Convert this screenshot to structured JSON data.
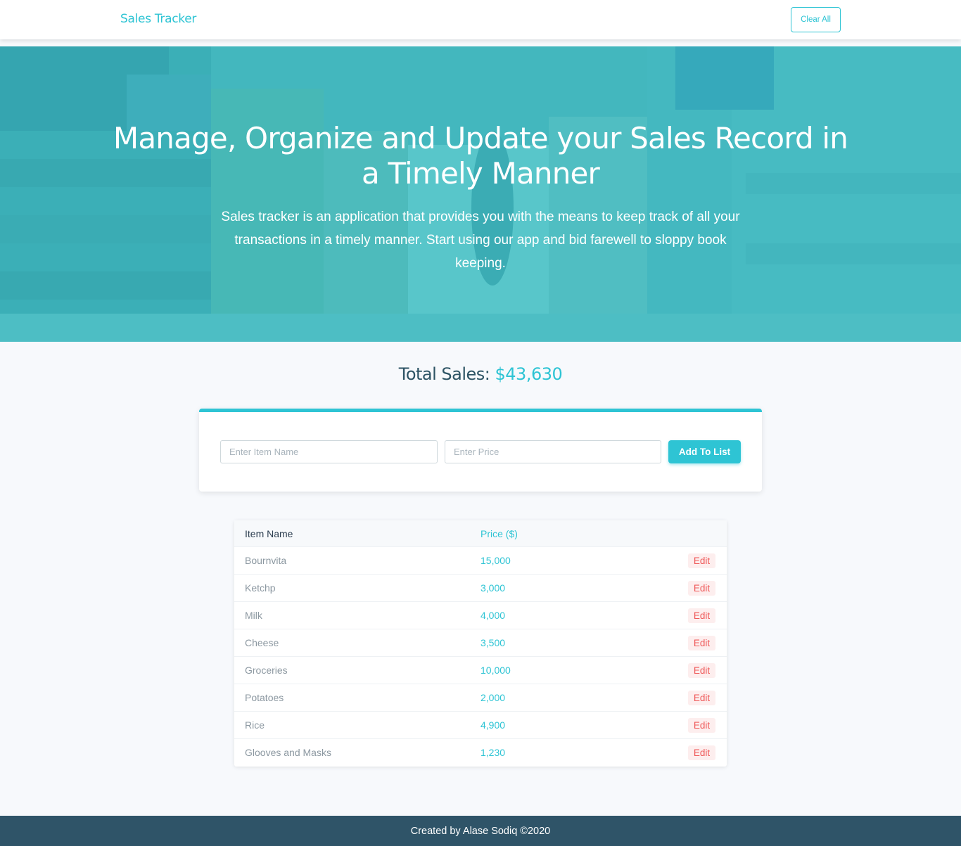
{
  "navbar": {
    "brand": "Sales Tracker",
    "clear_all_label": "Clear All"
  },
  "hero": {
    "title": "Manage, Organize and Update your Sales Record in a Timely Manner",
    "description": "Sales tracker is an application that provides you with the means to keep track of all your transactions in a timely manner. Start using our app and bid farewell to sloppy book keeping."
  },
  "total": {
    "label": "Total Sales: ",
    "value": "$43,630"
  },
  "form": {
    "item_placeholder": "Enter Item Name",
    "price_placeholder": "Enter Price",
    "add_label": "Add To List"
  },
  "table": {
    "headers": {
      "name": "Item Name",
      "price": "Price ($)"
    },
    "edit_label": "Edit",
    "rows": [
      {
        "name": "Bournvita",
        "price": "15,000"
      },
      {
        "name": "Ketchp",
        "price": "3,000"
      },
      {
        "name": "Milk",
        "price": "4,000"
      },
      {
        "name": "Cheese",
        "price": "3,500"
      },
      {
        "name": "Groceries",
        "price": "10,000"
      },
      {
        "name": "Potatoes",
        "price": "2,000"
      },
      {
        "name": "Rice",
        "price": "4,900"
      },
      {
        "name": "Glooves and Masks",
        "price": "1,230"
      }
    ]
  },
  "footer": {
    "text": "Created by Alase Sodiq ©2020"
  },
  "colors": {
    "accent": "#2ec4d4",
    "dark": "#2f5468",
    "edit": "#ef5a5a"
  }
}
